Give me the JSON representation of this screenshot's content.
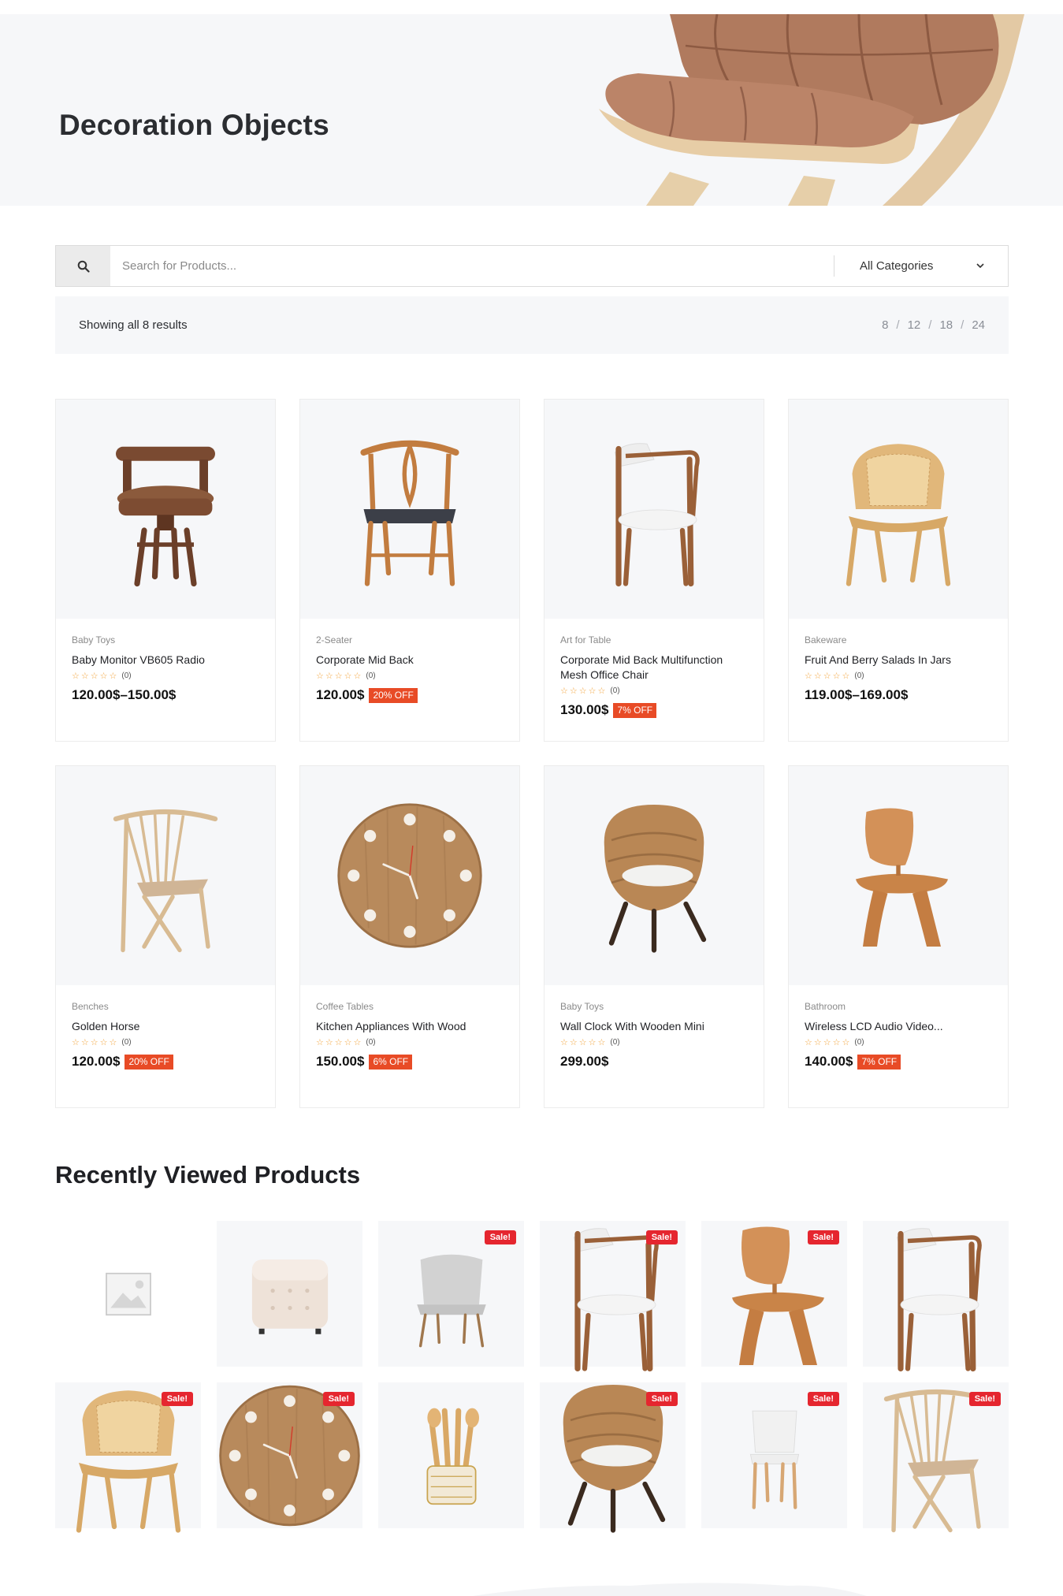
{
  "hero": {
    "title": "Decoration Objects"
  },
  "search": {
    "placeholder": "Search for Products...",
    "category": "All Categories"
  },
  "results": {
    "text": "Showing all 8 results",
    "per_page": [
      "8",
      "12",
      "18",
      "24"
    ]
  },
  "products": [
    {
      "category": "Baby Toys",
      "title": "Baby Monitor VB605 Radio",
      "rating_count": "(0)",
      "price": "120.00$–150.00$",
      "discount": "",
      "image": "swivel-leather-chair"
    },
    {
      "category": "2-Seater",
      "title": "Corporate Mid Back",
      "rating_count": "(0)",
      "price": "120.00$",
      "discount": "20% OFF",
      "image": "wishbone-chair"
    },
    {
      "category": "Art for Table",
      "title": "Corporate Mid Back Multifunction Mesh Office Chair",
      "rating_count": "(0)",
      "price": "130.00$",
      "discount": "7% OFF",
      "image": "wood-armchair-white"
    },
    {
      "category": "Bakeware",
      "title": "Fruit And Berry Salads In Jars",
      "rating_count": "(0)",
      "price": "119.00$–169.00$",
      "discount": "",
      "image": "rattan-armchair"
    },
    {
      "category": "Benches",
      "title": "Golden Horse",
      "rating_count": "(0)",
      "price": "120.00$",
      "discount": "20% OFF",
      "image": "spindle-chair"
    },
    {
      "category": "Coffee Tables",
      "title": "Kitchen Appliances With Wood",
      "rating_count": "(0)",
      "price": "150.00$",
      "discount": "6% OFF",
      "image": "wood-wall-clock"
    },
    {
      "category": "Baby Toys",
      "title": "Wall Clock With Wooden Mini",
      "rating_count": "(0)",
      "price": "299.00$",
      "discount": "",
      "image": "wicker-egg-chair"
    },
    {
      "category": "Bathroom",
      "title": "Wireless LCD Audio Video...",
      "rating_count": "(0)",
      "price": "140.00$",
      "discount": "7% OFF",
      "image": "plywood-lounge-chair"
    }
  ],
  "recently_viewed": {
    "title": "Recently Viewed Products",
    "sale_label": "Sale!",
    "items": [
      {
        "image": "placeholder-image",
        "sale": false
      },
      {
        "image": "tufted-ottoman",
        "sale": false
      },
      {
        "image": "grey-upholstered-chair",
        "sale": true
      },
      {
        "image": "wood-armchair-white",
        "sale": true
      },
      {
        "image": "plywood-lounge-chair",
        "sale": true
      },
      {
        "image": "wood-armchair-white",
        "sale": false
      },
      {
        "image": "rattan-armchair",
        "sale": true
      },
      {
        "image": "wood-wall-clock",
        "sale": true
      },
      {
        "image": "wooden-utensils",
        "sale": false
      },
      {
        "image": "wicker-egg-chair",
        "sale": true
      },
      {
        "image": "white-plastic-chair",
        "sale": true
      },
      {
        "image": "spindle-chair",
        "sale": true
      }
    ]
  },
  "colors": {
    "accent_off": "#e84b26",
    "sale_badge": "#e5262f",
    "star": "#f2a33a",
    "panel_bg": "#f6f7f9"
  }
}
